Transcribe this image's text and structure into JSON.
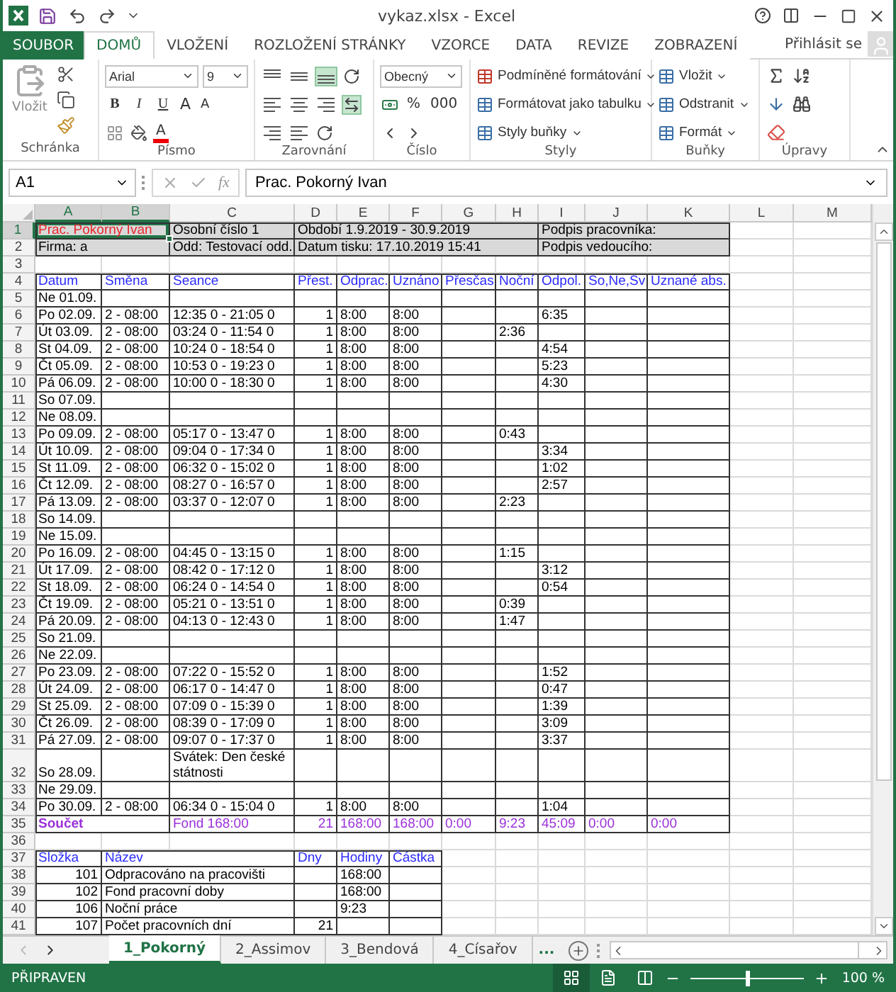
{
  "window": {
    "title": "vykaz.xlsx - Excel"
  },
  "ribbon_tabs": [
    {
      "label": "SOUBOR",
      "kind": "file",
      "selected": false
    },
    {
      "label": "DOMŮ",
      "kind": "tab",
      "selected": true
    },
    {
      "label": "VLOŽENÍ",
      "kind": "tab",
      "selected": false
    },
    {
      "label": "ROZLOŽENÍ STRÁNKY",
      "kind": "tab",
      "selected": false
    },
    {
      "label": "VZORCE",
      "kind": "tab",
      "selected": false
    },
    {
      "label": "DATA",
      "kind": "tab",
      "selected": false
    },
    {
      "label": "REVIZE",
      "kind": "tab",
      "selected": false
    },
    {
      "label": "ZOBRAZENÍ",
      "kind": "tab",
      "selected": false
    }
  ],
  "account": {
    "label": "Přihlásit se"
  },
  "ribbon": {
    "clipboard": {
      "group": "Schránka",
      "paste": "Vložit"
    },
    "font": {
      "group": "Písmo",
      "family": "Arial",
      "size": "9",
      "styles": [
        "B",
        "I",
        "U"
      ],
      "grow": "A",
      "shrink": "A",
      "color_letter": "A"
    },
    "alignment": {
      "group": "Zarovnání",
      "vertical": [
        {
          "on": false
        },
        {
          "on": false
        },
        {
          "on": true
        }
      ],
      "wrap_on": false,
      "merge_on": true
    },
    "number": {
      "group": "Číslo",
      "format": "Obecný",
      "percent": "%",
      "thousands": "000"
    },
    "styles": {
      "group": "Styly",
      "items": [
        "Podmíněné formátování",
        "Formátovat jako tabulku",
        "Styly buňky"
      ]
    },
    "cells": {
      "group": "Buňky",
      "items": [
        "Vložit",
        "Odstranit",
        "Formát"
      ]
    },
    "editing": {
      "group": "Úpravy"
    }
  },
  "formula_bar": {
    "name_box": "A1",
    "function_label": "fx",
    "value": "Prac. Pokorný Ivan"
  },
  "columns": [
    {
      "label": "A",
      "selected": true
    },
    {
      "label": "B",
      "selected": true
    },
    {
      "label": "C",
      "selected": false
    },
    {
      "label": "D",
      "selected": false
    },
    {
      "label": "E",
      "selected": false
    },
    {
      "label": "F",
      "selected": false
    },
    {
      "label": "G",
      "selected": false
    },
    {
      "label": "H",
      "selected": false
    },
    {
      "label": "I",
      "selected": false
    },
    {
      "label": "J",
      "selected": false
    },
    {
      "label": "K",
      "selected": false
    },
    {
      "label": "L",
      "selected": false
    },
    {
      "label": "M",
      "selected": false
    }
  ],
  "info_rows": [
    {
      "row": "1",
      "selected": true,
      "color": "#e8262b",
      "name": "Prac. Pokorný Ivan",
      "field_2": "Osobní číslo 1",
      "field_3": "Období 1.9.2019 - 30.9.2019",
      "signature": "Podpis pracovníka:"
    },
    {
      "row": "2",
      "selected": false,
      "color": "#000000",
      "name": "Firma: a",
      "field_2": "Odd: Testovací odd.",
      "field_3": "Datum tisku: 17.10.2019 15:41",
      "signature": "Podpis vedoucího:"
    }
  ],
  "gap_rows": [
    "3",
    "36"
  ],
  "table": {
    "header_row": "4",
    "columns": [
      "Datum",
      "Směna",
      "Seance",
      "Přest.",
      "Odprac.",
      "Uznáno",
      "Přesčas",
      "Noční",
      "Odpol.",
      "So,Ne,Sv",
      "Uznané abs."
    ],
    "rows": [
      {
        "row": "5",
        "datum": "Ne 01.09."
      },
      {
        "row": "6",
        "datum": "Po 02.09.",
        "smena": "2 - 08:00",
        "seance": "12:35 0 - 21:05 0",
        "prest": "1",
        "odprac": "8:00",
        "uznano": "8:00",
        "odpol": "6:35"
      },
      {
        "row": "7",
        "datum": "Út 03.09.",
        "smena": "2 - 08:00",
        "seance": "03:24 0 - 11:54 0",
        "prest": "1",
        "odprac": "8:00",
        "uznano": "8:00",
        "nocni": "2:36"
      },
      {
        "row": "8",
        "datum": "St 04.09.",
        "smena": "2 - 08:00",
        "seance": "10:24 0 - 18:54 0",
        "prest": "1",
        "odprac": "8:00",
        "uznano": "8:00",
        "odpol": "4:54"
      },
      {
        "row": "9",
        "datum": "Čt 05.09.",
        "smena": "2 - 08:00",
        "seance": "10:53 0 - 19:23 0",
        "prest": "1",
        "odprac": "8:00",
        "uznano": "8:00",
        "odpol": "5:23"
      },
      {
        "row": "10",
        "datum": "Pá 06.09.",
        "smena": "2 - 08:00",
        "seance": "10:00 0 - 18:30 0",
        "prest": "1",
        "odprac": "8:00",
        "uznano": "8:00",
        "odpol": "4:30"
      },
      {
        "row": "11",
        "datum": "So 07.09."
      },
      {
        "row": "12",
        "datum": "Ne 08.09."
      },
      {
        "row": "13",
        "datum": "Po 09.09.",
        "smena": "2 - 08:00",
        "seance": "05:17 0 - 13:47 0",
        "prest": "1",
        "odprac": "8:00",
        "uznano": "8:00",
        "nocni": "0:43"
      },
      {
        "row": "14",
        "datum": "Út 10.09.",
        "smena": "2 - 08:00",
        "seance": "09:04 0 - 17:34 0",
        "prest": "1",
        "odprac": "8:00",
        "uznano": "8:00",
        "odpol": "3:34"
      },
      {
        "row": "15",
        "datum": "St 11.09.",
        "smena": "2 - 08:00",
        "seance": "06:32 0 - 15:02 0",
        "prest": "1",
        "odprac": "8:00",
        "uznano": "8:00",
        "odpol": "1:02"
      },
      {
        "row": "16",
        "datum": "Čt 12.09.",
        "smena": "2 - 08:00",
        "seance": "08:27 0 - 16:57 0",
        "prest": "1",
        "odprac": "8:00",
        "uznano": "8:00",
        "odpol": "2:57"
      },
      {
        "row": "17",
        "datum": "Pá 13.09.",
        "smena": "2 - 08:00",
        "seance": "03:37 0 - 12:07 0",
        "prest": "1",
        "odprac": "8:00",
        "uznano": "8:00",
        "nocni": "2:23"
      },
      {
        "row": "18",
        "datum": "So 14.09."
      },
      {
        "row": "19",
        "datum": "Ne 15.09."
      },
      {
        "row": "20",
        "datum": "Po 16.09.",
        "smena": "2 - 08:00",
        "seance": "04:45 0 - 13:15 0",
        "prest": "1",
        "odprac": "8:00",
        "uznano": "8:00",
        "nocni": "1:15"
      },
      {
        "row": "21",
        "datum": "Út 17.09.",
        "smena": "2 - 08:00",
        "seance": "08:42 0 - 17:12 0",
        "prest": "1",
        "odprac": "8:00",
        "uznano": "8:00",
        "odpol": "3:12"
      },
      {
        "row": "22",
        "datum": "St 18.09.",
        "smena": "2 - 08:00",
        "seance": "06:24 0 - 14:54 0",
        "prest": "1",
        "odprac": "8:00",
        "uznano": "8:00",
        "odpol": "0:54"
      },
      {
        "row": "23",
        "datum": "Čt 19.09.",
        "smena": "2 - 08:00",
        "seance": "05:21 0 - 13:51 0",
        "prest": "1",
        "odprac": "8:00",
        "uznano": "8:00",
        "nocni": "0:39"
      },
      {
        "row": "24",
        "datum": "Pá 20.09.",
        "smena": "2 - 08:00",
        "seance": "04:13 0 - 12:43 0",
        "prest": "1",
        "odprac": "8:00",
        "uznano": "8:00",
        "nocni": "1:47"
      },
      {
        "row": "25",
        "datum": "So 21.09."
      },
      {
        "row": "26",
        "datum": "Ne 22.09."
      },
      {
        "row": "27",
        "datum": "Po 23.09.",
        "smena": "2 - 08:00",
        "seance": "07:22 0 - 15:52 0",
        "prest": "1",
        "odprac": "8:00",
        "uznano": "8:00",
        "odpol": "1:52"
      },
      {
        "row": "28",
        "datum": "Út 24.09.",
        "smena": "2 - 08:00",
        "seance": "06:17 0 - 14:47 0",
        "prest": "1",
        "odprac": "8:00",
        "uznano": "8:00",
        "odpol": "0:47"
      },
      {
        "row": "29",
        "datum": "St 25.09.",
        "smena": "2 - 08:00",
        "seance": "07:09 0 - 15:39 0",
        "prest": "1",
        "odprac": "8:00",
        "uznano": "8:00",
        "odpol": "1:39"
      },
      {
        "row": "30",
        "datum": "Čt 26.09.",
        "smena": "2 - 08:00",
        "seance": "08:39 0 - 17:09 0",
        "prest": "1",
        "odprac": "8:00",
        "uznano": "8:00",
        "odpol": "3:09"
      },
      {
        "row": "31",
        "datum": "Pá 27.09.",
        "smena": "2 - 08:00",
        "seance": "09:07 0 - 17:37 0",
        "prest": "1",
        "odprac": "8:00",
        "uznano": "8:00",
        "odpol": "3:37"
      },
      {
        "row": "32",
        "datum": "So 28.09.",
        "seance": "Svátek: Den české státnosti"
      },
      {
        "row": "33",
        "datum": "Ne 29.09."
      },
      {
        "row": "34",
        "datum": "Po 30.09.",
        "smena": "2 - 08:00",
        "seance": "06:34 0 - 15:04 0",
        "prest": "1",
        "odprac": "8:00",
        "uznano": "8:00",
        "odpol": "1:04"
      }
    ],
    "total": {
      "row": "35",
      "label": "Součet",
      "seance": "Fond 168:00",
      "prest": "21",
      "odprac": "168:00",
      "uznano": "168:00",
      "prescas": "0:00",
      "nocni": "9:23",
      "odpol": "45:09",
      "so_ne_sv": "0:00",
      "uznane_abs": "0:00"
    }
  },
  "components": {
    "header_row": "37",
    "columns": [
      "Složka",
      "Název",
      "Dny",
      "Hodiny",
      "Částka"
    ],
    "rows": [
      {
        "row": "38",
        "code": "101",
        "name": "Odpracováno na pracovišti",
        "hours": "168:00"
      },
      {
        "row": "39",
        "code": "102",
        "name": "Fond pracovní doby",
        "hours": "168:00"
      },
      {
        "row": "40",
        "code": "106",
        "name": "Noční práce",
        "hours": "9:23"
      },
      {
        "row": "41",
        "code": "107",
        "name": "Počet pracovních dní",
        "days": "21"
      }
    ]
  },
  "sheet_tabs": [
    {
      "label": "1_Pokorný",
      "selected": true
    },
    {
      "label": "2_Assimov",
      "selected": false
    },
    {
      "label": "3_Bendová",
      "selected": false
    },
    {
      "label": "4_Císařov",
      "selected": false
    }
  ],
  "more_tabs": "...",
  "status_bar": {
    "text": "PŘIPRAVEN",
    "view_buttons": [
      {
        "kind": "normal",
        "selected": true
      },
      {
        "kind": "page_layout",
        "selected": false
      },
      {
        "kind": "page_break",
        "selected": false
      }
    ],
    "zoom_slider": {
      "level": 0.5
    },
    "zoom": "100 %"
  }
}
